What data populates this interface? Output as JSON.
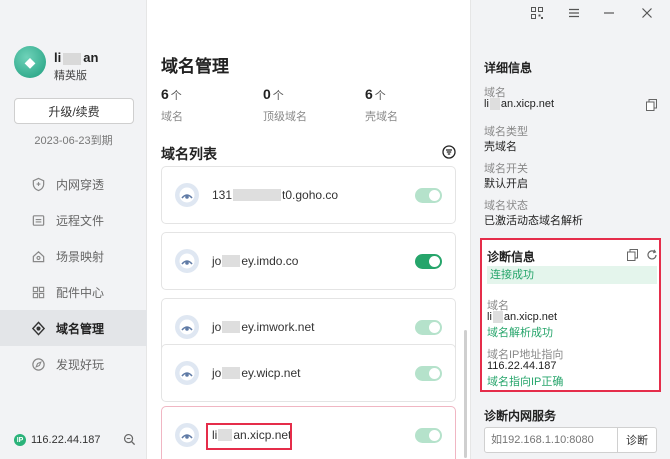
{
  "sidebar": {
    "logo_glyph": "◆",
    "username_prefix": "li",
    "username_suffix": "an",
    "edition": "精英版",
    "upgrade_label": "升级/续费",
    "expire_text": "2023-06-23到期",
    "items": [
      {
        "label": "内网穿透",
        "icon": "shield-icon"
      },
      {
        "label": "远程文件",
        "icon": "file-icon"
      },
      {
        "label": "场景映射",
        "icon": "home-icon"
      },
      {
        "label": "配件中心",
        "icon": "grid-icon"
      },
      {
        "label": "域名管理",
        "icon": "domain-icon",
        "active": true
      },
      {
        "label": "发现好玩",
        "icon": "compass-icon"
      }
    ],
    "ip_badge": "IP",
    "ip": "116.22.44.187"
  },
  "main": {
    "title": "域名管理",
    "stats": [
      {
        "value": "6",
        "unit": "个",
        "label": "域名"
      },
      {
        "value": "0",
        "unit": "个",
        "label": "顶级域名"
      },
      {
        "value": "6",
        "unit": "个",
        "label": "壳域名"
      }
    ],
    "list_title": "域名列表",
    "domains": [
      {
        "prefix": "131",
        "suffix": "t0.goho.co",
        "enabled": false,
        "selected": false
      },
      {
        "prefix": "jo",
        "suffix": "ey.imdo.co",
        "enabled": true,
        "selected": false
      },
      {
        "prefix": "jo",
        "suffix": "ey.imwork.net",
        "enabled": false,
        "selected": false
      },
      {
        "prefix": "jo",
        "suffix": "ey.wicp.net",
        "enabled": false,
        "selected": false
      },
      {
        "prefix": "li",
        "suffix": "an.xicp.net",
        "enabled": false,
        "selected": true
      }
    ]
  },
  "detail": {
    "title": "详细信息",
    "domain_label": "域名",
    "domain_prefix": "li",
    "domain_suffix": "an.xicp.net",
    "type_label": "域名类型",
    "type_value": "壳域名",
    "switch_label": "域名开关",
    "switch_value": "默认开启",
    "status_label": "域名状态",
    "status_value": "已激活动态域名解析"
  },
  "diagnosis": {
    "title": "诊断信息",
    "connection_status": "连接成功",
    "domain_label": "域名",
    "domain_prefix": "li",
    "domain_suffix": "an.xicp.net",
    "resolve_ok": "域名解析成功",
    "ip_label": "域名IP地址指向",
    "ip_value": "116.22.44.187",
    "ip_ok": "域名指向IP正确"
  },
  "net_diag": {
    "title": "诊断内网服务",
    "placeholder": "如192.168.1.10:8080",
    "button": "诊断"
  },
  "colors": {
    "accent_green": "#26a56b",
    "highlight_red": "#e52d4a"
  }
}
